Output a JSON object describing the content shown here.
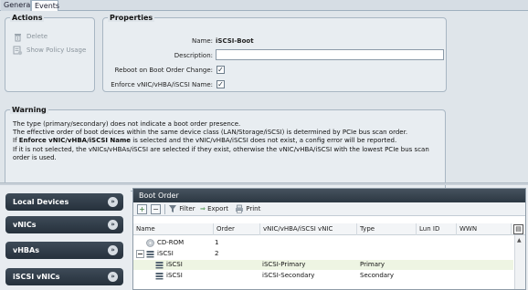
{
  "tabs": [
    {
      "label": "General",
      "active": false
    },
    {
      "label": "Events",
      "active": true
    }
  ],
  "actions": {
    "title": "Actions",
    "items": [
      {
        "label": "Delete",
        "icon": "trash-icon"
      },
      {
        "label": "Show Policy Usage",
        "icon": "policy-usage-icon"
      }
    ]
  },
  "properties": {
    "title": "Properties",
    "name_label": "Name:",
    "name_value": "iSCSI-Boot",
    "description_label": "Description:",
    "description_value": "",
    "reboot_label": "Reboot on Boot Order Change:",
    "reboot_checked": true,
    "enforce_label": "Enforce vNIC/vHBA/iSCSI Name:",
    "enforce_checked": true
  },
  "warning": {
    "title": "Warning",
    "line1": "The type (primary/secondary) does not indicate a boot order presence.",
    "line2": "The effective order of boot devices within the same device class (LAN/Storage/iSCSI) is determined by PCIe bus scan order.",
    "line3_pre": "If ",
    "line3_bold": "Enforce vNIC/vHBA/iSCSI Name",
    "line3_post": " is selected and the vNIC/vHBA/iSCSI does not exist, a config error will be reported.",
    "line4": "If it is not selected, the vNICs/vHBAs/iSCSI are selected if they exist, otherwise the vNIC/vHBA/iSCSI with the lowest PCIe bus scan",
    "line5": "order is used."
  },
  "left_nav": [
    {
      "label": "Local Devices"
    },
    {
      "label": "vNICs"
    },
    {
      "label": "vHBAs"
    },
    {
      "label": "iSCSI vNICs"
    }
  ],
  "boot_order": {
    "title": "Boot Order",
    "toolbar": {
      "add": "+",
      "remove": "−",
      "filter": "Filter",
      "export": "Export",
      "print": "Print"
    },
    "columns": [
      "Name",
      "Order",
      "vNIC/vHBA/iSCSI vNIC",
      "Type",
      "Lun ID",
      "WWN"
    ],
    "rows": [
      {
        "name": "CD-ROM",
        "order": "1",
        "vnic": "",
        "type": "",
        "lun": "",
        "wwn": "",
        "level": 0,
        "icon": "cdrom-icon"
      },
      {
        "name": "iSCSI",
        "order": "2",
        "vnic": "",
        "type": "",
        "lun": "",
        "wwn": "",
        "level": 0,
        "icon": "iscsi-group-icon"
      },
      {
        "name": "iSCSI",
        "order": "",
        "vnic": "iSCSI-Primary",
        "type": "Primary",
        "lun": "",
        "wwn": "",
        "level": 1,
        "icon": "iscsi-icon"
      },
      {
        "name": "iSCSI",
        "order": "",
        "vnic": "iSCSI-Secondary",
        "type": "Secondary",
        "lun": "",
        "wwn": "",
        "level": 1,
        "icon": "iscsi-icon"
      }
    ]
  }
}
